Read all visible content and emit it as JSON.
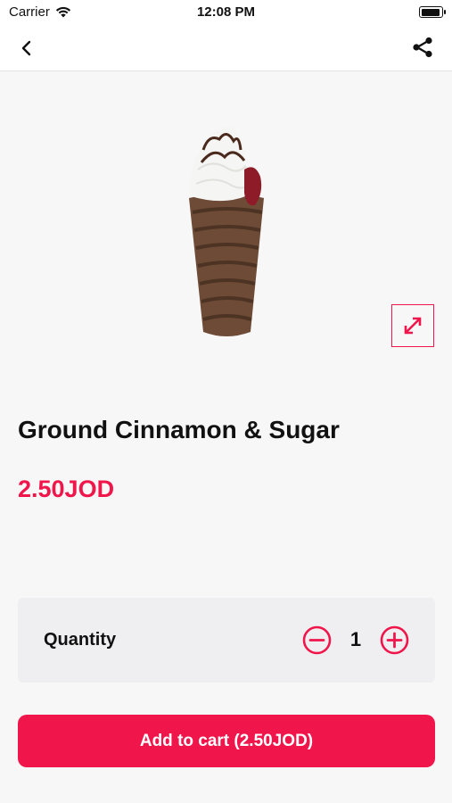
{
  "status_bar": {
    "carrier": "Carrier",
    "time": "12:08 PM"
  },
  "nav": {
    "back_icon": "chevron-left-icon",
    "share_icon": "share-icon"
  },
  "product": {
    "title": "Ground Cinnamon & Sugar",
    "price": "2.50JOD",
    "image_icon": "expand-icon"
  },
  "quantity": {
    "label": "Quantity",
    "value": "1",
    "minus_icon": "minus-circle-icon",
    "plus_icon": "plus-circle-icon"
  },
  "cart": {
    "button_label": "Add to cart (2.50JOD)"
  },
  "colors": {
    "accent": "#f0164b",
    "background": "#f7f7f8",
    "card": "#efeff2"
  }
}
